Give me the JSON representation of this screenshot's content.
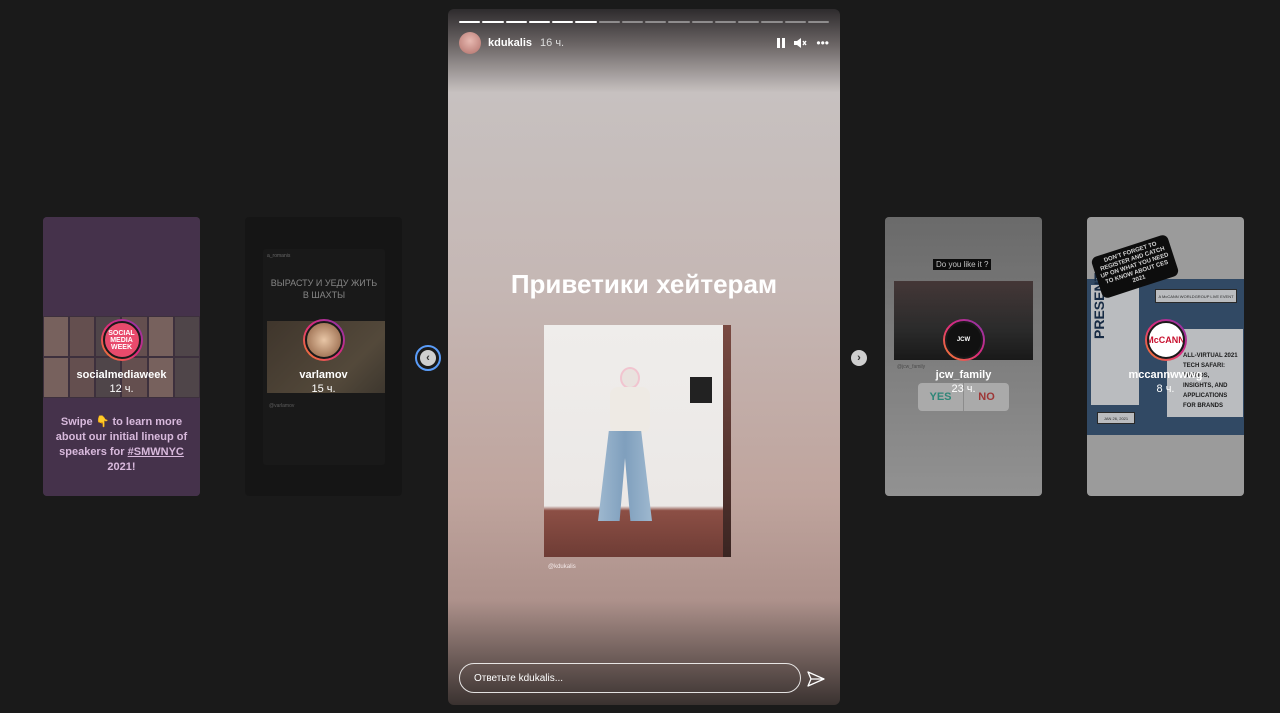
{
  "side_stories": {
    "card1": {
      "username": "socialmediaweek",
      "time": "12 ч.",
      "avatar_text": "SOCIAL MEDIA WEEK",
      "promo_text": "Swipe 👇 to learn more about our initial lineup of speakers for",
      "promo_tag": "#SMWNYC",
      "promo_year": " 2021!"
    },
    "card2": {
      "username": "varlamov",
      "time": "15 ч.",
      "inner_head": "a_romanis",
      "inner_title": "ВЫРАСТУ И УЕДУ ЖИТЬ В ШАХТЫ",
      "inner_caption": "@varlamov"
    },
    "card3": {
      "username": "jcw_family",
      "time": "23 ч.",
      "question": "Do you like it ?",
      "tagline": "@jcw_family",
      "poll_yes": "YES",
      "poll_no": "NO"
    },
    "card4": {
      "username": "mccannwwwg",
      "time": "8 ч.",
      "avatar_text": "McCANN",
      "sticker": "DON'T FORGET TO REGISTER AND CATCH UP ON WHAT YOU NEED TO KNOW ABOUT CES 2021",
      "presents": "PRESENTS",
      "banner": "A McCANN WORLDGROUP LIVE EVENT",
      "poster_text": "ALL-VIRTUAL 2021 TECH SAFARI: TRENDS, INSIGHTS, AND APPLICATIONS FOR BRANDS",
      "date": "JAN 26, 2021"
    }
  },
  "nav": {
    "prev_icon": "‹",
    "next_icon": "›"
  },
  "story": {
    "progress_total": 16,
    "progress_done": 6,
    "username": "kdukalis",
    "time": "16 ч.",
    "headline": "Приветики хейтерам",
    "photo_caption": "@kdukalis",
    "reply_placeholder": "Ответьте kdukalis...",
    "more_icon": "•••"
  }
}
